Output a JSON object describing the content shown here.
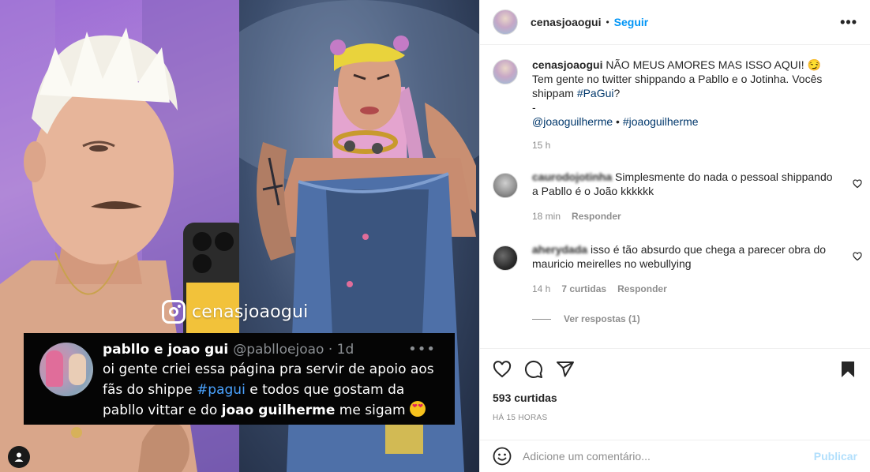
{
  "media": {
    "watermark": "cenasjoaogui",
    "tweet": {
      "name": "pabllo e joao gui",
      "handle": "@pablloejoao · 1d",
      "more": "•••",
      "line1": "oi gente criei essa página pra servir de apoio aos",
      "line2_a": "fãs do shippe ",
      "line2_tag": "#pagui",
      "line2_b": " e todos que gostam da",
      "line3_a": "pabllo vittar e do ",
      "line3_bold": "joao guilherme",
      "line3_b": " me sigam "
    }
  },
  "header": {
    "username": "cenasjoaogui",
    "separator": "•",
    "follow": "Seguir",
    "more": "•••"
  },
  "caption": {
    "username": "cenasjoaogui",
    "text1": "NÃO MEUS AMORES MAS ISSO AQUI! 😏",
    "text2": "Tem gente no twitter shippando a Pabllo e o Jotinha. Vocês shippam ",
    "hashtag": "#PaGui",
    "text2_end": "?",
    "dash": "-",
    "mention1": "@joaoguilherme",
    "sep": " • ",
    "mention2": "#joaoguilherme",
    "time": "15 h"
  },
  "comments": [
    {
      "username": "caurodojotinha",
      "text": "Simplesmente do nada o pessoal shippando a Pabllo é o João kkkkkk",
      "time": "18 min",
      "reply": "Responder"
    },
    {
      "username": "aherydada",
      "text": "isso é tão absurdo que chega a parecer obra do mauricio meirelles no webullying",
      "time": "14 h",
      "likes": "7 curtidas",
      "reply": "Responder",
      "view_replies": "Ver respostas (1)"
    }
  ],
  "actions": {
    "likes": "593 curtidas",
    "time": "HÁ 15 HORAS"
  },
  "add_comment": {
    "placeholder": "Adicione um comentário...",
    "publish": "Publicar"
  }
}
